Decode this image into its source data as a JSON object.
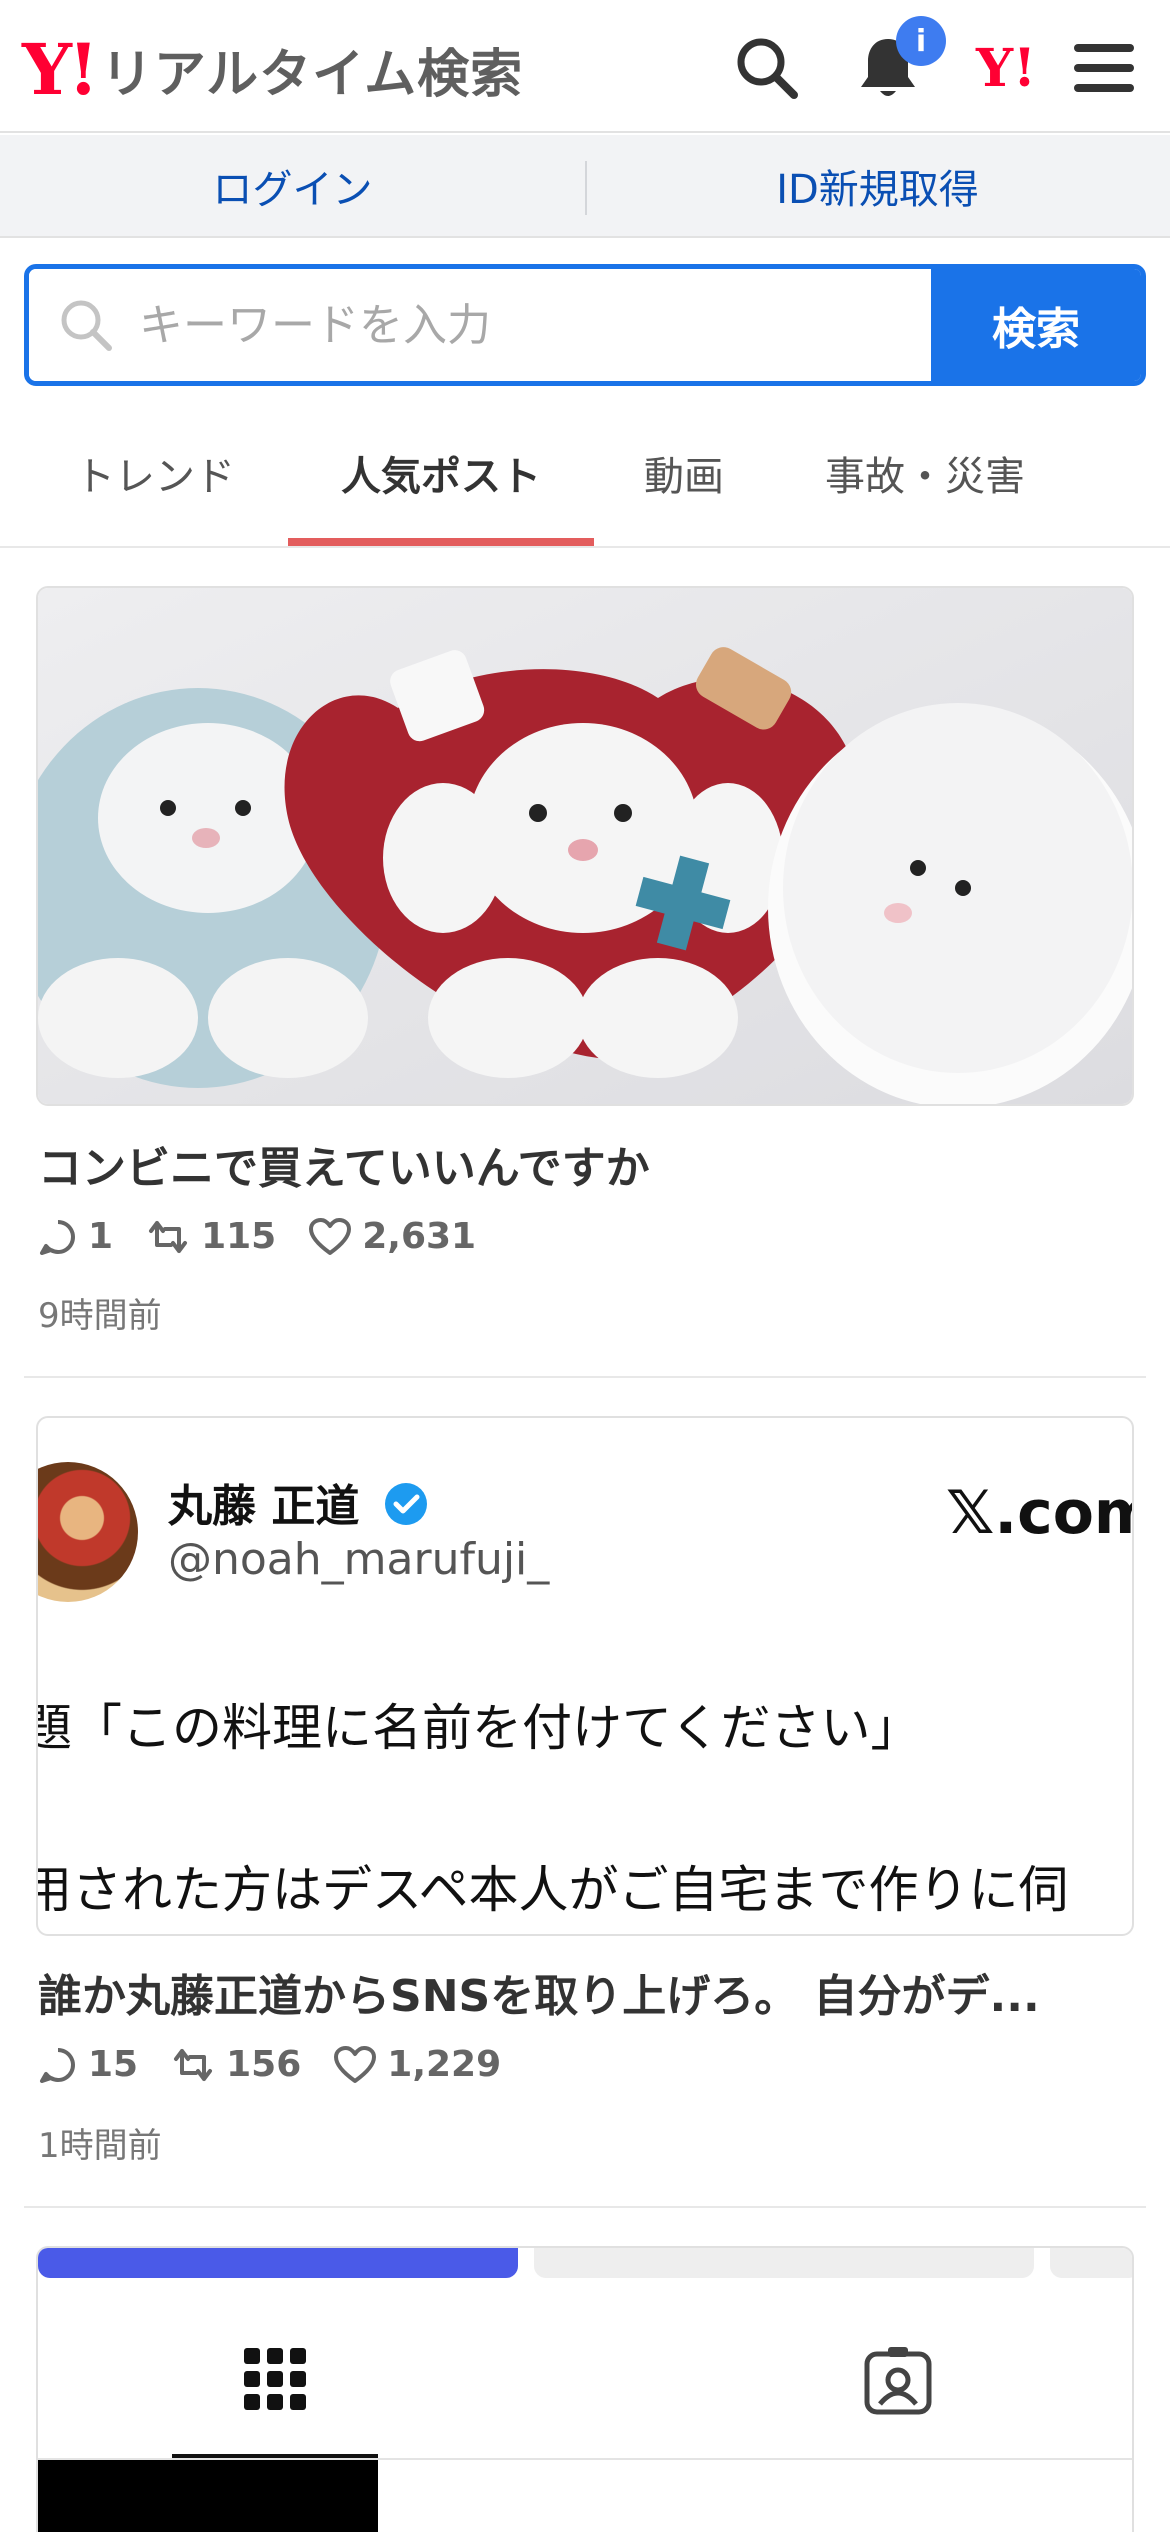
{
  "header": {
    "logo_mark": "Y!",
    "logo_text": "リアルタイム検索",
    "notification_badge": "i"
  },
  "auth": {
    "login": "ログイン",
    "register": "ID新規取得"
  },
  "search": {
    "placeholder": "キーワードを入力",
    "button": "検索"
  },
  "tabs": [
    {
      "label": "トレンド",
      "active": false
    },
    {
      "label": "人気ポスト",
      "active": true
    },
    {
      "label": "動画",
      "active": false
    },
    {
      "label": "事故・災害",
      "active": false
    }
  ],
  "posts": [
    {
      "title": "コンビニで買えていいんですか",
      "replies": "1",
      "reposts": "115",
      "likes": "2,631",
      "time": "9時間前"
    },
    {
      "title": "誰か丸藤正道からSNSを取り上げろ。 自分がデ...",
      "replies": "15",
      "reposts": "156",
      "likes": "1,229",
      "time": "1時間前",
      "card": {
        "name": "丸藤 正道",
        "handle": "@noah_marufuji_",
        "source": "𝕏.com",
        "line1": "題「この料理に名前を付けてください」",
        "line2": "用された方はデスペ本人がご自宅まで作りに伺"
      }
    }
  ],
  "colors": {
    "brand_red": "#ff0033",
    "link_blue": "#0a4fb3",
    "search_blue": "#1a73e8",
    "tab_underline": "#e35d5d",
    "badge_blue": "#3e7cf0"
  }
}
